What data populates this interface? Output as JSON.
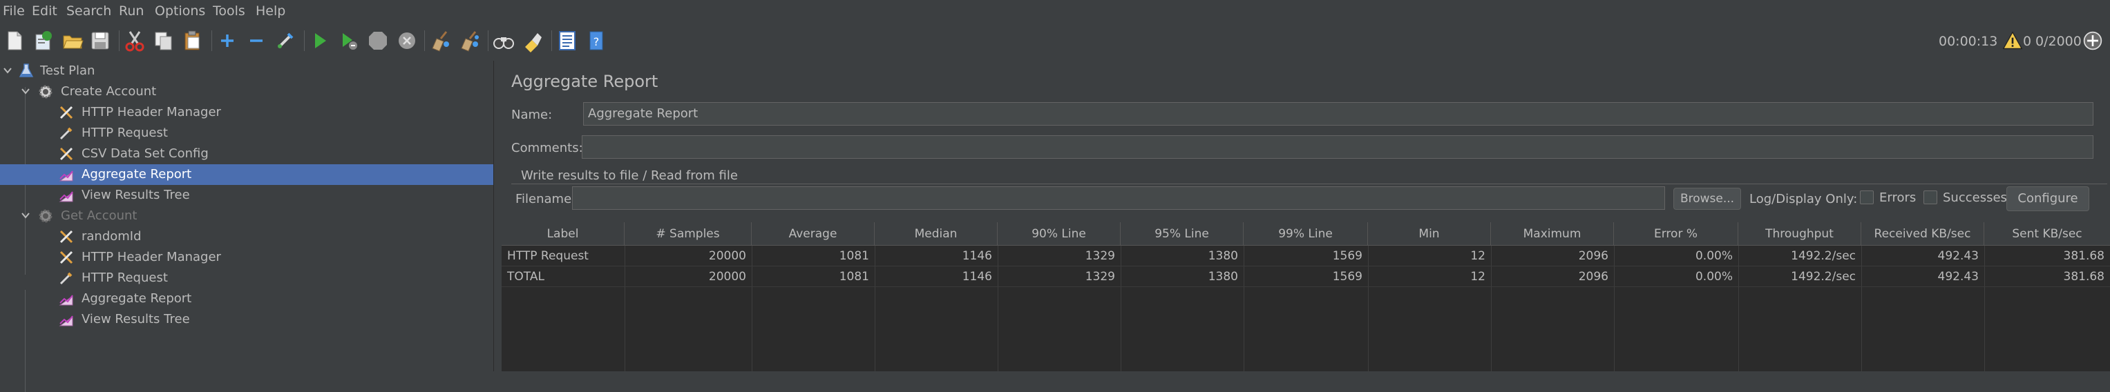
{
  "menu": [
    "File",
    "Edit",
    "Search",
    "Run",
    "Options",
    "Tools",
    "Help"
  ],
  "toolbar": {
    "elapsed": "00:00:13",
    "warnings": "0",
    "threads": "0/2000"
  },
  "tree": {
    "items": [
      {
        "label": "Test Plan",
        "icon": "flask-icon"
      },
      {
        "label": "Create Account",
        "icon": "gear-icon"
      },
      {
        "label": "HTTP Header Manager",
        "icon": "wrench-screwdriver-icon"
      },
      {
        "label": "HTTP Request",
        "icon": "pipette-icon"
      },
      {
        "label": "CSV Data Set Config",
        "icon": "wrench-screwdriver-icon"
      },
      {
        "label": "Aggregate Report",
        "icon": "chart-icon"
      },
      {
        "label": "View Results Tree",
        "icon": "chart-icon"
      },
      {
        "label": "Get Account",
        "icon": "gear-icon"
      },
      {
        "label": "randomId",
        "icon": "wrench-screwdriver-icon"
      },
      {
        "label": "HTTP Header Manager",
        "icon": "wrench-screwdriver-icon"
      },
      {
        "label": "HTTP Request",
        "icon": "pipette-icon"
      },
      {
        "label": "Aggregate Report",
        "icon": "chart-icon"
      },
      {
        "label": "View Results Tree",
        "icon": "chart-icon"
      }
    ]
  },
  "panel": {
    "title": "Aggregate Report",
    "name_label": "Name:",
    "name_value": "Aggregate Report",
    "comments_label": "Comments:",
    "comments_value": "",
    "group_title": "Write results to file / Read from file",
    "filename_label": "Filename",
    "filename_value": "",
    "browse": "Browse...",
    "log_display": "Log/Display Only:",
    "errors": "Errors",
    "successes": "Successes",
    "configure": "Configure"
  },
  "table": {
    "headers": [
      "Label",
      "# Samples",
      "Average",
      "Median",
      "90% Line",
      "95% Line",
      "99% Line",
      "Min",
      "Maximum",
      "Error %",
      "Throughput",
      "Received KB/sec",
      "Sent KB/sec"
    ],
    "rows": [
      [
        "HTTP Request",
        "20000",
        "1081",
        "1146",
        "1329",
        "1380",
        "1569",
        "12",
        "2096",
        "0.00%",
        "1492.2/sec",
        "492.43",
        "381.68"
      ],
      [
        "TOTAL",
        "20000",
        "1081",
        "1146",
        "1329",
        "1380",
        "1569",
        "12",
        "2096",
        "0.00%",
        "1492.2/sec",
        "492.43",
        "381.68"
      ]
    ]
  }
}
